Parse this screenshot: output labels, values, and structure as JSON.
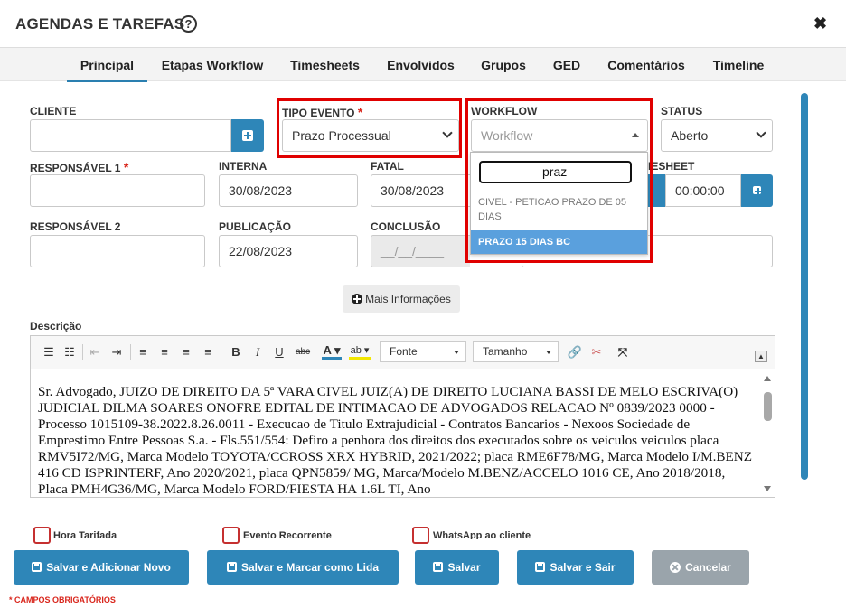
{
  "modal": {
    "title": "AGENDAS E TAREFAS",
    "help": "?",
    "close": "✖"
  },
  "tabs": [
    {
      "label": "Principal"
    },
    {
      "label": "Etapas Workflow"
    },
    {
      "label": "Timesheets"
    },
    {
      "label": "Envolvidos"
    },
    {
      "label": "Grupos"
    },
    {
      "label": "GED"
    },
    {
      "label": "Comentários"
    },
    {
      "label": "Timeline"
    }
  ],
  "form": {
    "cliente": {
      "label": "CLIENTE",
      "value": ""
    },
    "tipo_evento": {
      "label": "TIPO EVENTO",
      "value": "Prazo Processual"
    },
    "workflow": {
      "label": "WORKFLOW",
      "placeholder": "Workflow"
    },
    "status": {
      "label": "STATUS",
      "value": "Aberto"
    },
    "responsavel1": {
      "label": "RESPONSÁVEL 1",
      "value": ""
    },
    "interna": {
      "label": "INTERNA",
      "value": "30/08/2023"
    },
    "fatal": {
      "label": "FATAL",
      "value": "30/08/2023"
    },
    "timesheet": {
      "label": "IESHEET",
      "value": "00:00:00"
    },
    "responsavel2": {
      "label": "RESPONSÁVEL 2",
      "value": ""
    },
    "publicacao": {
      "label": "PUBLICAÇÃO",
      "value": "22/08/2023"
    },
    "conclusao": {
      "label": "CONCLUSÃO",
      "value": "__/__/____"
    },
    "required_mark": "*"
  },
  "workflow_dropdown": {
    "search_value": "praz",
    "options": [
      {
        "label": "CIVEL - PETICAO PRAZO DE 05 DIAS",
        "highlighted": false
      },
      {
        "label": "PRAZO 15 DIAS BC",
        "highlighted": true
      }
    ]
  },
  "mais_info": "Mais Informações",
  "descricao": {
    "label": "Descrição",
    "font_select": "Fonte",
    "size_select": "Tamanho",
    "text": "Sr. Advogado, JUIZO DE DIREITO DA 5ª VARA CIVEL JUIZ(A) DE DIREITO LUCIANA BASSI DE MELO ESCRIVA(O) JUDICIAL DILMA SOARES ONOFRE EDITAL DE INTIMACAO DE ADVOGADOS RELACAO Nº 0839/2023 0000 - Processo 1015109-38.2022.8.26.0011 - Execucao de Titulo Extrajudicial - Contratos Bancarios - Nexoos Sociedade de Emprestimo Entre Pessoas S.a. - Fls.551/554: Defiro a penhora dos direitos dos executados sobre os veiculos veiculos placa RMV5I72/MG, Marca Modelo TOYOTA/CCROSS XRX HYBRID, 2021/2022; placa RME6F78/MG, Marca Modelo I/M.BENZ 416 CD ISPRINTERF, Ano 2020/2021, placa QPN5859/ MG, Marca/Modelo M.BENZ/ACCELO 1016 CE, Ano 2018/2018, Placa PMH4G36/MG, Marca Modelo FORD/FIESTA HA 1.6L TI, Ano"
  },
  "checkboxes": [
    {
      "label": "Hora Tarifada"
    },
    {
      "label": "Evento Recorrente"
    },
    {
      "label": "WhatsApp ao cliente"
    }
  ],
  "actions": [
    {
      "label": "Salvar e Adicionar Novo"
    },
    {
      "label": "Salvar e Marcar como Lida"
    },
    {
      "label": "Salvar"
    },
    {
      "label": "Salvar e Sair"
    },
    {
      "label": "Cancelar"
    }
  ],
  "footer_note": "* CAMPOS OBRIGATÓRIOS",
  "colors": {
    "primary": "#2e86b8",
    "highlight_red": "#e00000",
    "required": "#d9261c",
    "disabled": "#9aa4ab"
  }
}
